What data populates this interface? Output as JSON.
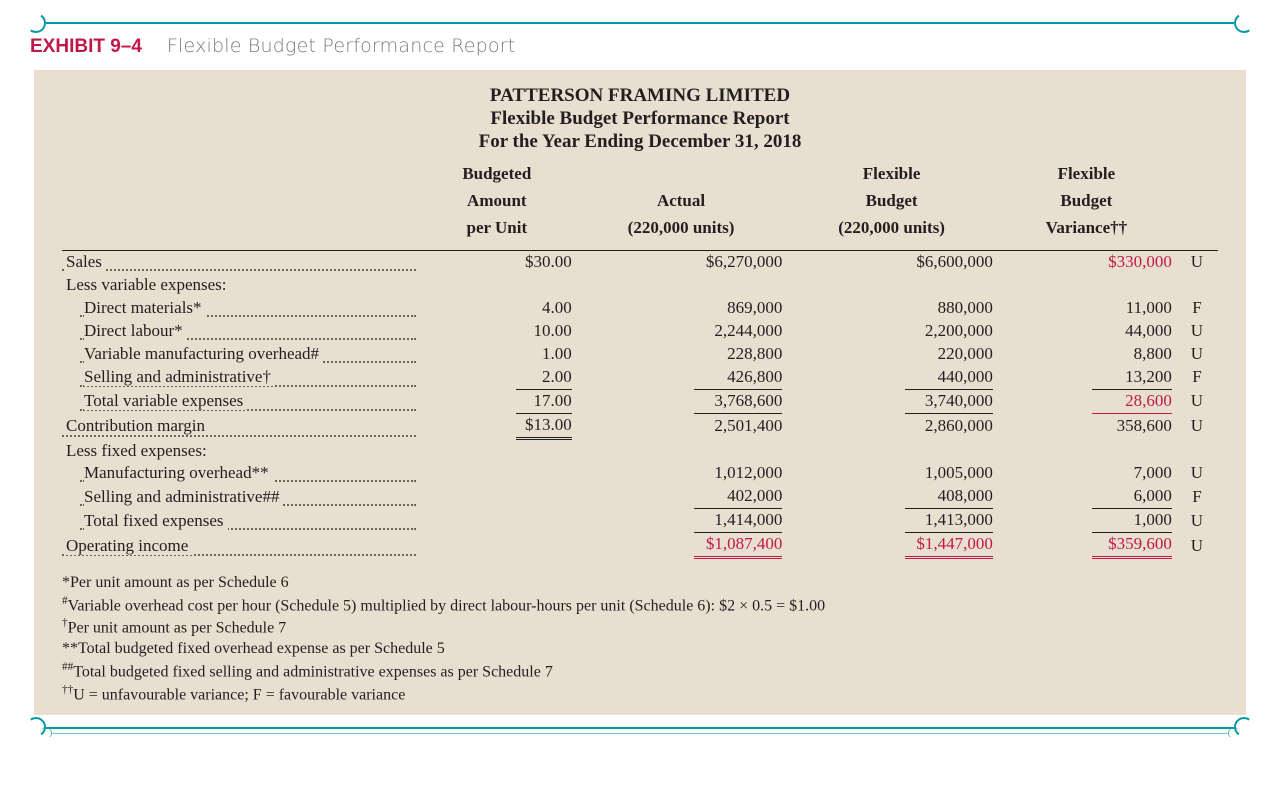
{
  "exhibit": {
    "label": "EXHIBIT 9–4",
    "title": "Flexible Budget Performance Report"
  },
  "report": {
    "company": "PATTERSON FRAMING LIMITED",
    "title": "Flexible Budget Performance Report",
    "period": "For the Year Ending December 31, 2018"
  },
  "columns": {
    "per": {
      "l1": "Budgeted",
      "l2": "Amount",
      "l3": "per Unit"
    },
    "act": {
      "l1": "",
      "l2": "Actual",
      "l3": "(220,000 units)"
    },
    "flex": {
      "l1": "Flexible",
      "l2": "Budget",
      "l3": "(220,000 units)"
    },
    "var": {
      "l1": "Flexible",
      "l2": "Budget",
      "l3": "Variance††"
    }
  },
  "rows": {
    "sales": {
      "label": "Sales",
      "per": "$30.00",
      "act": "$6,270,000",
      "flex": "$6,600,000",
      "var": "$330,000",
      "uf": "U"
    },
    "lessVarHdr": {
      "label": "Less variable expenses:"
    },
    "dm": {
      "label": "Direct materials*",
      "per": "4.00",
      "act": "869,000",
      "flex": "880,000",
      "var": "11,000",
      "uf": "F"
    },
    "dl": {
      "label": "Direct labour*",
      "per": "10.00",
      "act": "2,244,000",
      "flex": "2,200,000",
      "var": "44,000",
      "uf": "U"
    },
    "vmo": {
      "label": "Variable manufacturing overhead#",
      "per": "1.00",
      "act": "228,800",
      "flex": "220,000",
      "var": "8,800",
      "uf": "U"
    },
    "vsanda": {
      "label": "Selling and administrative†",
      "per": "2.00",
      "act": "426,800",
      "flex": "440,000",
      "var": "13,200",
      "uf": "F"
    },
    "totVar": {
      "label": "Total variable expenses",
      "per": "17.00",
      "act": "3,768,600",
      "flex": "3,740,000",
      "var": "28,600",
      "uf": "U"
    },
    "cm": {
      "label": "Contribution margin",
      "per": "$13.00",
      "act": "2,501,400",
      "flex": "2,860,000",
      "var": "358,600",
      "uf": "U"
    },
    "lessFixHdr": {
      "label": "Less fixed expenses:"
    },
    "fmo": {
      "label": "Manufacturing overhead**",
      "act": "1,012,000",
      "flex": "1,005,000",
      "var": "7,000",
      "uf": "U"
    },
    "fsanda": {
      "label": "Selling and administrative##",
      "act": "402,000",
      "flex": "408,000",
      "var": "6,000",
      "uf": "F"
    },
    "totFix": {
      "label": "Total fixed expenses",
      "act": "1,414,000",
      "flex": "1,413,000",
      "var": "1,000",
      "uf": "U"
    },
    "opinc": {
      "label": "Operating income",
      "act": "$1,087,400",
      "flex": "$1,447,000",
      "var": "$359,600",
      "uf": "U"
    }
  },
  "footnotes": {
    "a": "*Per unit amount as per Schedule 6",
    "b": "#Variable overhead cost per hour (Schedule 5) multiplied by direct labour-hours per unit (Schedule 6): $2 × 0.5 = $1.00",
    "c": "†Per unit amount as per Schedule 7",
    "d": "**Total budgeted fixed overhead expense as per Schedule 5",
    "e": "##Total budgeted fixed selling and administrative expenses as per Schedule 7",
    "f": "††U = unfavourable variance; F = favourable variance"
  }
}
